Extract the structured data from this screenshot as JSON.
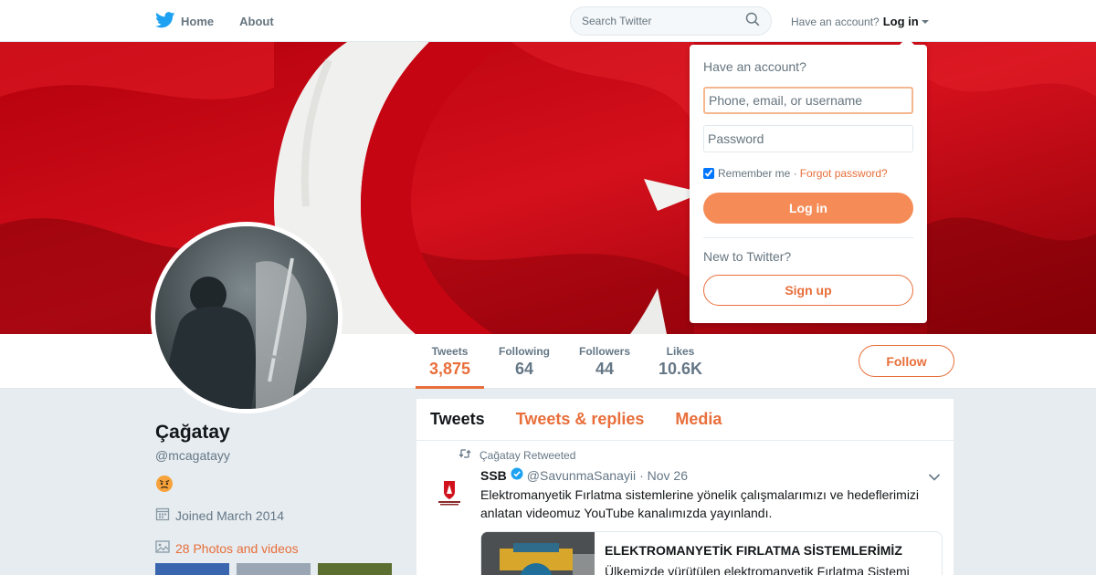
{
  "nav": {
    "home_label": "Home",
    "about_label": "About",
    "search_placeholder": "Search Twitter",
    "have_account_text": "Have an account?",
    "login_label": "Log in"
  },
  "profile": {
    "name": "Çağatay",
    "handle": "@mcagatayy",
    "joined": "Joined March 2014",
    "photos_label": "28 Photos and videos",
    "follow_label": "Follow"
  },
  "stats": [
    {
      "label": "Tweets",
      "value": "3,875"
    },
    {
      "label": "Following",
      "value": "64"
    },
    {
      "label": "Followers",
      "value": "44"
    },
    {
      "label": "Likes",
      "value": "10.6K"
    }
  ],
  "timeline": {
    "tabs": [
      "Tweets",
      "Tweets & replies",
      "Media"
    ],
    "tweet": {
      "retweet_context": "Çağatay Retweeted",
      "author_name": "SSB",
      "author_handle": "@SavunmaSanayii",
      "time": "· Nov 26",
      "text": "Elektromanyetik Fırlatma sistemlerine yönelik çalışmalarımızı ve hedeflerimizi anlatan videomuz YouTube kanalımızda yayınlandı.",
      "card_title": "ELEKTROMANYETİK FIRLATMA SİSTEMLERİMİZ",
      "card_description": "Ülkemizde yürütülen elektromanyetik Fırlatma Sistemi"
    }
  },
  "login_dropdown": {
    "title": "Have an account?",
    "username_placeholder": "Phone, email, or username",
    "password_placeholder": "Password",
    "remember_label": "Remember me ·",
    "forgot_label": "Forgot password?",
    "login_button": "Log in",
    "new_to_twitter": "New to Twitter?",
    "signup_button": "Sign up"
  },
  "colors": {
    "accent": "#e86e3a",
    "twitter_blue": "#1da1f2",
    "banner_red": "#c8000f"
  }
}
